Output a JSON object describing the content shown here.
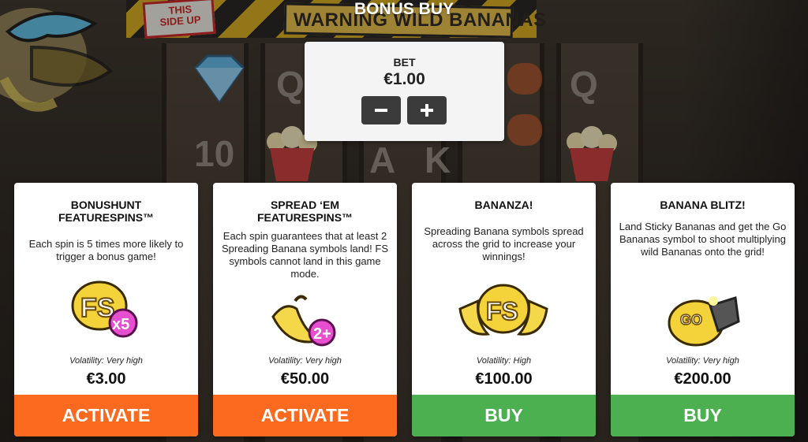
{
  "title": "BONUS BUY",
  "background": {
    "warning_sign": "WARNING WILD BANANAS",
    "sticker_line1": "THIS",
    "sticker_line2": "SIDE UP",
    "glyphs": [
      "Q",
      "10",
      "A",
      "K",
      "Q"
    ]
  },
  "bet": {
    "label": "BET",
    "value": "€1.00",
    "minus_icon": "minus-icon",
    "plus_icon": "plus-icon"
  },
  "colors": {
    "activate": "#fb6a1e",
    "buy": "#4caf50",
    "panel": "#f4f4f4"
  },
  "cards": [
    {
      "title": "BONUSHUNT\nFEATURESPINS™",
      "description": "Each spin is 5 times more likely to trigger a bonus game!",
      "icon": "fs-x5-icon",
      "volatility": "Volatility: Very high",
      "price": "€3.00",
      "button": "ACTIVATE"
    },
    {
      "title": "SPREAD ‘EM\nFEATURESPINS™",
      "description": "Each spin guarantees that at least 2 Spreading Banana symbols land! FS symbols cannot land in this game mode.",
      "icon": "banana-2plus-icon",
      "volatility": "Volatility: Very high",
      "price": "€50.00",
      "button": "ACTIVATE"
    },
    {
      "title": "BANANZA!",
      "description": "Spreading Banana symbols spread across the grid to increase your winnings!",
      "icon": "fs-bananas-icon",
      "volatility": "Volatility: High",
      "price": "€100.00",
      "button": "BUY"
    },
    {
      "title": "BANANA BLITZ!",
      "description": "Land Sticky Bananas and get the Go Bananas symbol to shoot multiplying wild Bananas onto the grid!",
      "icon": "go-bananas-icon",
      "volatility": "Volatility: Very high",
      "price": "€200.00",
      "button": "BUY"
    }
  ]
}
